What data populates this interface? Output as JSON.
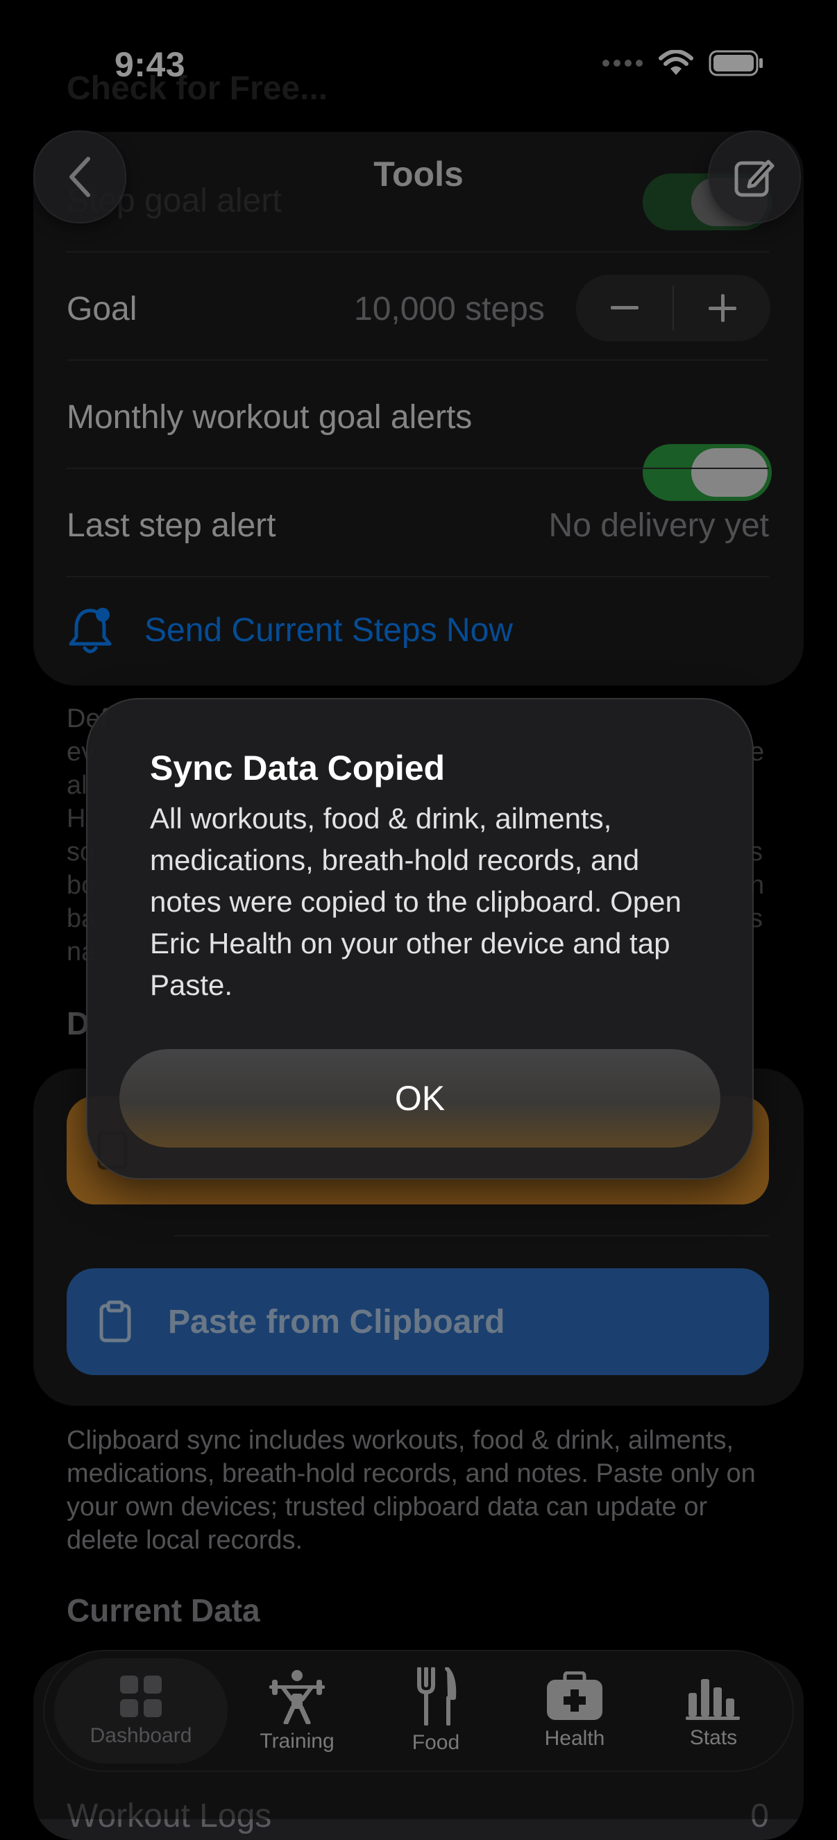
{
  "status": {
    "time": "9:43"
  },
  "nav": {
    "title": "Tools"
  },
  "background_header": "Check for Free...",
  "settings": {
    "step_goal_alert": "Step goal alert",
    "goal_label": "Goal",
    "goal_value": "10,000 steps",
    "monthly_label": "Monthly workout goal alerts",
    "last_step_label": "Last step alert",
    "last_step_value": "No delivery yet",
    "send_now": "Send Current Steps Now"
  },
  "obscured_text": {
    "lines_left": [
      "Def",
      "ev",
      "al",
      "H",
      "so",
      "bo",
      "ba",
      "na"
    ],
    "lines_right": [
      "e",
      "s",
      "n",
      "s"
    ],
    "section_initial": "D"
  },
  "sync": {
    "paste_button": "Paste from Clipboard",
    "footnote": "Clipboard sync includes workouts, food & drink, ailments, medications, breath-hold records, and notes. Paste only on your own devices; trusted clipboard data can update or delete local records."
  },
  "current_data": {
    "heading": "Current Data",
    "workout_logs": "Workout Logs",
    "workout_logs_count": "0"
  },
  "alert": {
    "title": "Sync Data Copied",
    "message": "All workouts, food & drink, ailments, medications, breath-hold records, and notes were copied to the clipboard. Open Eric Health on your other device and tap Paste.",
    "ok": "OK"
  },
  "tabs": [
    {
      "label": "Dashboard",
      "icon": "grid-icon"
    },
    {
      "label": "Training",
      "icon": "weightlifter-icon"
    },
    {
      "label": "Food",
      "icon": "fork-knife-icon"
    },
    {
      "label": "Health",
      "icon": "medkit-icon"
    },
    {
      "label": "Stats",
      "icon": "bar-chart-icon"
    }
  ],
  "colors": {
    "accent_blue": "#0a84ff",
    "toggle_green": "#2ea043",
    "orange_button": "#d98e2c",
    "blue_button": "#2f6fbf"
  }
}
